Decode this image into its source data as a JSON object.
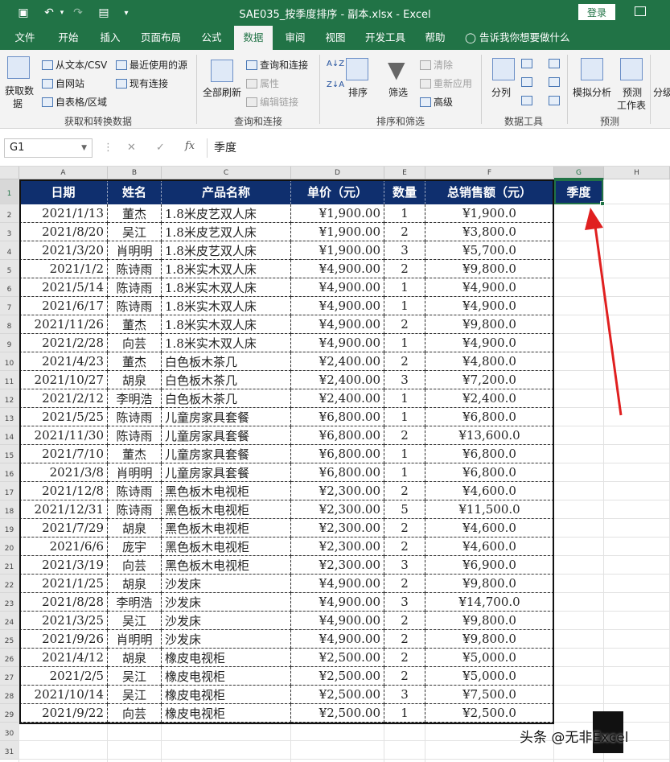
{
  "window": {
    "title": "SAE035_按季度排序 - 副本.xlsx - Excel",
    "login_label": "登录"
  },
  "tabs": [
    "文件",
    "开始",
    "插入",
    "页面布局",
    "公式",
    "数据",
    "审阅",
    "视图",
    "开发工具",
    "帮助"
  ],
  "active_tab": "数据",
  "tell_me": "告诉我你想要做什么",
  "ribbon": {
    "get_data": "获取数\n据",
    "get_data_line1": "获取数",
    "get_data_line2": "据",
    "from_text": "从文本/CSV",
    "from_web": "自网站",
    "from_table": "自表格/区域",
    "recent_sources": "最近使用的源",
    "existing_connections": "现有连接",
    "group_get": "获取和转换数据",
    "refresh_all": "全部刷新",
    "queries_connections": "查询和连接",
    "properties": "属性",
    "edit_links": "编辑链接",
    "group_queries": "查询和连接",
    "sort": "排序",
    "filter": "筛选",
    "clear": "清除",
    "reapply": "重新应用",
    "advanced": "高级",
    "group_sort": "排序和筛选",
    "text_to_columns": "分列",
    "group_tools": "数据工具",
    "what_if": "模拟分析",
    "forecast_sheet_line1": "预测",
    "forecast_sheet_line2": "工作表",
    "group_forecast": "预测",
    "outline": "分级"
  },
  "formula_bar": {
    "name_box": "G1",
    "fx": "fx",
    "content": "季度"
  },
  "columns": [
    "A",
    "B",
    "C",
    "D",
    "E",
    "F",
    "G",
    "H"
  ],
  "selected_column": "G",
  "selected_row": 1,
  "table": {
    "headers": [
      "日期",
      "姓名",
      "产品名称",
      "单价（元）",
      "数量",
      "总销售额（元）"
    ],
    "extra_header": "季度",
    "rows": [
      [
        "2021/1/13",
        "董杰",
        "1.8米皮艺双人床",
        "¥1,900.00",
        "1",
        "¥1,900.0"
      ],
      [
        "2021/8/20",
        "吴江",
        "1.8米皮艺双人床",
        "¥1,900.00",
        "2",
        "¥3,800.0"
      ],
      [
        "2021/3/20",
        "肖明明",
        "1.8米皮艺双人床",
        "¥1,900.00",
        "3",
        "¥5,700.0"
      ],
      [
        "2021/1/2",
        "陈诗雨",
        "1.8米实木双人床",
        "¥4,900.00",
        "2",
        "¥9,800.0"
      ],
      [
        "2021/5/14",
        "陈诗雨",
        "1.8米实木双人床",
        "¥4,900.00",
        "1",
        "¥4,900.0"
      ],
      [
        "2021/6/17",
        "陈诗雨",
        "1.8米实木双人床",
        "¥4,900.00",
        "1",
        "¥4,900.0"
      ],
      [
        "2021/11/26",
        "董杰",
        "1.8米实木双人床",
        "¥4,900.00",
        "2",
        "¥9,800.0"
      ],
      [
        "2021/2/28",
        "向芸",
        "1.8米实木双人床",
        "¥4,900.00",
        "1",
        "¥4,900.0"
      ],
      [
        "2021/4/23",
        "董杰",
        "白色板木茶几",
        "¥2,400.00",
        "2",
        "¥4,800.0"
      ],
      [
        "2021/10/27",
        "胡泉",
        "白色板木茶几",
        "¥2,400.00",
        "3",
        "¥7,200.0"
      ],
      [
        "2021/2/12",
        "李明浩",
        "白色板木茶几",
        "¥2,400.00",
        "1",
        "¥2,400.0"
      ],
      [
        "2021/5/25",
        "陈诗雨",
        "儿童房家具套餐",
        "¥6,800.00",
        "1",
        "¥6,800.0"
      ],
      [
        "2021/11/30",
        "陈诗雨",
        "儿童房家具套餐",
        "¥6,800.00",
        "2",
        "¥13,600.0"
      ],
      [
        "2021/7/10",
        "董杰",
        "儿童房家具套餐",
        "¥6,800.00",
        "1",
        "¥6,800.0"
      ],
      [
        "2021/3/8",
        "肖明明",
        "儿童房家具套餐",
        "¥6,800.00",
        "1",
        "¥6,800.0"
      ],
      [
        "2021/12/8",
        "陈诗雨",
        "黑色板木电视柜",
        "¥2,300.00",
        "2",
        "¥4,600.0"
      ],
      [
        "2021/12/31",
        "陈诗雨",
        "黑色板木电视柜",
        "¥2,300.00",
        "5",
        "¥11,500.0"
      ],
      [
        "2021/7/29",
        "胡泉",
        "黑色板木电视柜",
        "¥2,300.00",
        "2",
        "¥4,600.0"
      ],
      [
        "2021/6/6",
        "庞宇",
        "黑色板木电视柜",
        "¥2,300.00",
        "2",
        "¥4,600.0"
      ],
      [
        "2021/3/19",
        "向芸",
        "黑色板木电视柜",
        "¥2,300.00",
        "3",
        "¥6,900.0"
      ],
      [
        "2021/1/25",
        "胡泉",
        "沙发床",
        "¥4,900.00",
        "2",
        "¥9,800.0"
      ],
      [
        "2021/8/28",
        "李明浩",
        "沙发床",
        "¥4,900.00",
        "3",
        "¥14,700.0"
      ],
      [
        "2021/3/25",
        "吴江",
        "沙发床",
        "¥4,900.00",
        "2",
        "¥9,800.0"
      ],
      [
        "2021/9/26",
        "肖明明",
        "沙发床",
        "¥4,900.00",
        "2",
        "¥9,800.0"
      ],
      [
        "2021/4/12",
        "胡泉",
        "橡皮电视柜",
        "¥2,500.00",
        "2",
        "¥5,000.0"
      ],
      [
        "2021/2/5",
        "吴江",
        "橡皮电视柜",
        "¥2,500.00",
        "2",
        "¥5,000.0"
      ],
      [
        "2021/10/14",
        "吴江",
        "橡皮电视柜",
        "¥2,500.00",
        "3",
        "¥7,500.0"
      ],
      [
        "2021/9/22",
        "向芸",
        "橡皮电视柜",
        "¥2,500.00",
        "1",
        "¥2,500.0"
      ]
    ]
  },
  "row_numbers": [
    "1",
    "2",
    "3",
    "4",
    "5",
    "6",
    "7",
    "8",
    "9",
    "10",
    "11",
    "12",
    "13",
    "14",
    "15",
    "16",
    "17",
    "18",
    "19",
    "20",
    "21",
    "22",
    "23",
    "24",
    "25",
    "26",
    "27",
    "28",
    "29",
    "30",
    "31"
  ],
  "colors": {
    "excel_green": "#217346",
    "header_navy": "#0f2f6e",
    "arrow_red": "#e02020"
  },
  "watermark": "头条 @无非Excel"
}
